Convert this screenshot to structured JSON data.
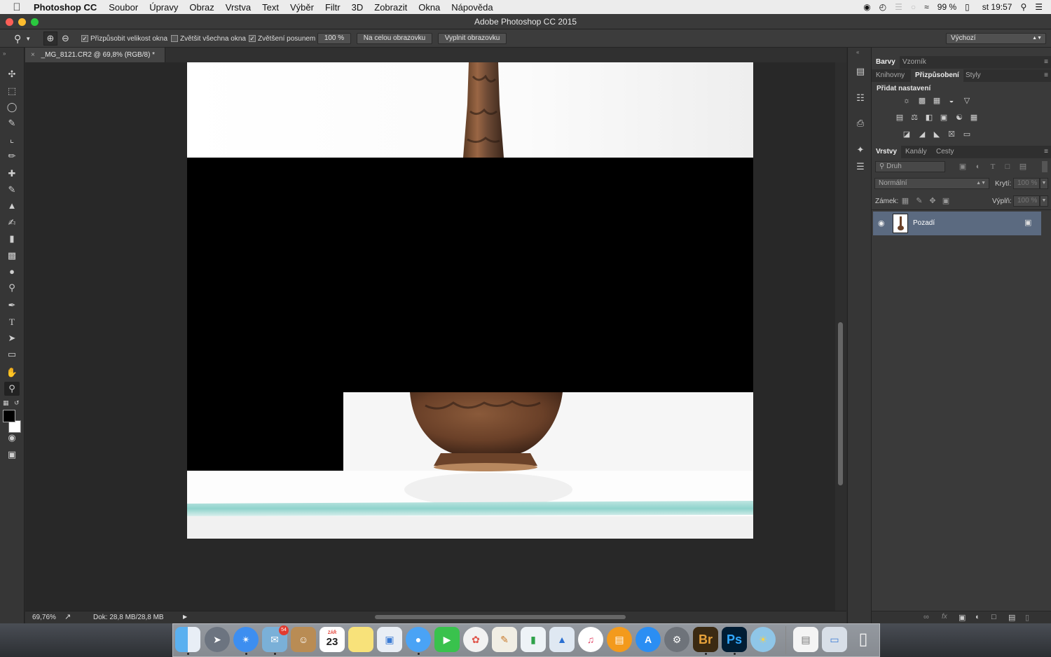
{
  "menubar": {
    "app": "Photoshop CC",
    "items": [
      "Soubor",
      "Úpravy",
      "Obraz",
      "Vrstva",
      "Text",
      "Výběr",
      "Filtr",
      "3D",
      "Zobrazit",
      "Okna",
      "Nápověda"
    ],
    "battery": "99 %",
    "clock": "st 19:57"
  },
  "window": {
    "title": "Adobe Photoshop CC 2015"
  },
  "options": {
    "fit_window": "Přizpůsobit velikost okna",
    "zoom_all": "Zvětšit všechna okna",
    "scrubby_zoom": "Zvětšení posunem",
    "zoom_value": "100 %",
    "full_screen": "Na celou obrazovku",
    "fill_screen": "Vyplnit obrazovku",
    "workspace": "Výchozí"
  },
  "document": {
    "tab_title": "_MG_8121.CR2 @ 69,8% (RGB/8) *",
    "zoom": "69,76%",
    "doc_size": "Dok: 28,8 MB/28,8 MB"
  },
  "panels": {
    "color_tabs": [
      "Barvy",
      "Vzorník"
    ],
    "adjust_tabs": [
      "Knihovny",
      "Přizpůsobení",
      "Styly"
    ],
    "add_adjustment": "Přidat nastavení",
    "layers_tabs": [
      "Vrstvy",
      "Kanály",
      "Cesty"
    ],
    "filter_kind": "Druh",
    "blend_mode": "Normální",
    "opacity_label": "Krytí:",
    "opacity_value": "100 %",
    "lock_label": "Zámek:",
    "fill_label": "Výplň:",
    "fill_value": "100 %",
    "layer_name": "Pozadí"
  },
  "dock": {
    "calendar_month": "ZÁŘ",
    "calendar_day": "23",
    "mail_badge": "54",
    "bridge": "Br",
    "photoshop": "Ps"
  },
  "colors": {
    "selected_layer": "#5b6a80",
    "canvas_bg": "#282828",
    "panel_bg": "#3a3a3a"
  }
}
